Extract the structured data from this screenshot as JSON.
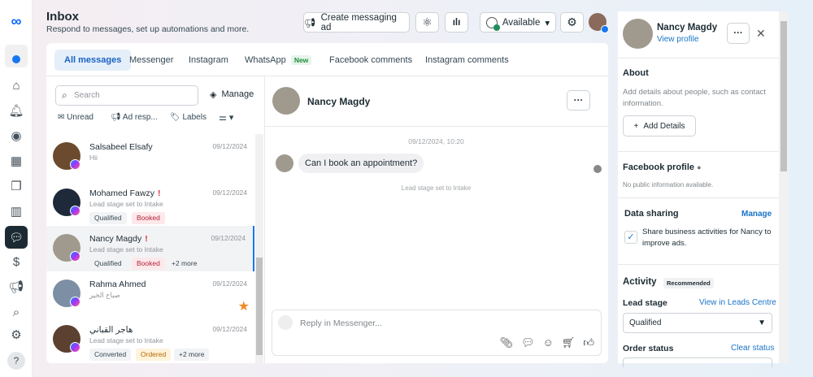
{
  "header": {
    "title": "Inbox",
    "subtitle": "Respond to messages, set up automations and more.",
    "create_ad": "Create messaging ad",
    "status": "Available"
  },
  "tabs": [
    {
      "label": "All messages"
    },
    {
      "label": "Messenger"
    },
    {
      "label": "Instagram"
    },
    {
      "label": "WhatsApp",
      "badge": "New"
    },
    {
      "label": "Facebook comments"
    },
    {
      "label": "Instagram comments"
    }
  ],
  "list": {
    "search_placeholder": "Search",
    "manage": "Manage",
    "filters": [
      "Unread",
      "Ad resp...",
      "Labels"
    ],
    "items": [
      {
        "name": "Salsabeel Elsafy",
        "preview": "Hii",
        "date": "09/12/2024"
      },
      {
        "name": "Mohamed Fawzy",
        "preview": "Lead stage set to Intake",
        "date": "09/12/2024",
        "tags": [
          "Qualified",
          "Booked"
        ],
        "alert": "!"
      },
      {
        "name": "Nancy Magdy",
        "preview": "Lead stage set to Intake",
        "date": "09/12/2024",
        "tags": [
          "Qualified",
          "Booked"
        ],
        "more": "+2 more",
        "alert": "!"
      },
      {
        "name": "Rahma Ahmed",
        "preview": "صباح الخير",
        "date": "09/12/2024"
      },
      {
        "name": "هاجر القباني",
        "preview": "Lead stage set to Intake",
        "date": "09/12/2024",
        "tags": [
          "Converted",
          "Ordered"
        ],
        "more": "+2 more"
      }
    ]
  },
  "chat": {
    "name": "Nancy Magdy",
    "timestamp": "09/12/2024, 10:20",
    "message": "Can I book an appointment?",
    "event": "Lead stage set to Intake",
    "reply_placeholder": "Reply in Messenger..."
  },
  "panel": {
    "name": "Nancy Magdy",
    "view_profile": "View profile",
    "about": "About",
    "about_desc": "Add details about people, such as contact information.",
    "add_details": "Add Details",
    "fb_profile": "Facebook profile",
    "fb_desc": "No public information available.",
    "data_sharing": "Data sharing",
    "manage": "Manage",
    "share_text": "Share business activities for Nancy to improve ads.",
    "activity": "Activity",
    "recommended": "Recommended",
    "lead_stage": "Lead stage",
    "view_leads": "View in Leads Centre",
    "lead_value": "Qualified",
    "order_status": "Order status",
    "clear_status": "Clear status"
  }
}
